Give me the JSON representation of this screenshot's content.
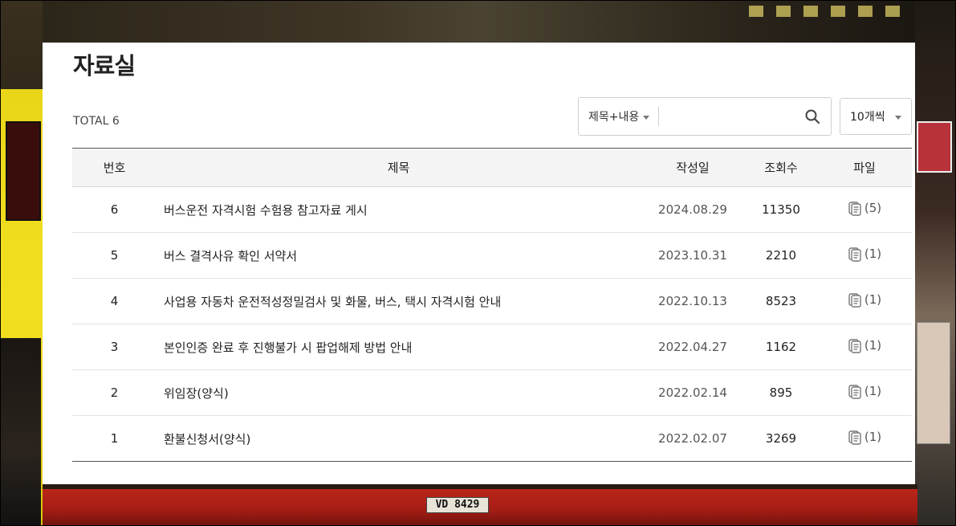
{
  "page": {
    "title": "자료실",
    "total_label": "TOTAL 6"
  },
  "search": {
    "scope": "제목+내용",
    "value": "",
    "placeholder": "",
    "per_page": "10개씩"
  },
  "table": {
    "headers": {
      "no": "번호",
      "title": "제목",
      "date": "작성일",
      "views": "조회수",
      "file": "파일"
    },
    "rows": [
      {
        "no": "6",
        "title": "버스운전 자격시험 수험용 참고자료 게시",
        "date": "2024.08.29",
        "views": "11350",
        "files": "(5)"
      },
      {
        "no": "5",
        "title": "버스 결격사유 확인 서약서",
        "date": "2023.10.31",
        "views": "2210",
        "files": "(1)"
      },
      {
        "no": "4",
        "title": "사업용 자동차 운전적성정밀검사 및 화물, 버스, 택시 자격시험 안내",
        "date": "2022.10.13",
        "views": "8523",
        "files": "(1)"
      },
      {
        "no": "3",
        "title": "본인인증 완료 후 진행불가 시 팝업해제 방법 안내",
        "date": "2022.04.27",
        "views": "1162",
        "files": "(1)"
      },
      {
        "no": "2",
        "title": "위임장(양식)",
        "date": "2022.02.14",
        "views": "895",
        "files": "(1)"
      },
      {
        "no": "1",
        "title": "환불신청서(양식)",
        "date": "2022.02.07",
        "views": "3269",
        "files": "(1)"
      }
    ]
  },
  "background": {
    "plate_text": "VD 8429"
  },
  "icons": {
    "search": "search-icon",
    "file": "file-icon",
    "dropdown": "chevron-down-icon"
  }
}
